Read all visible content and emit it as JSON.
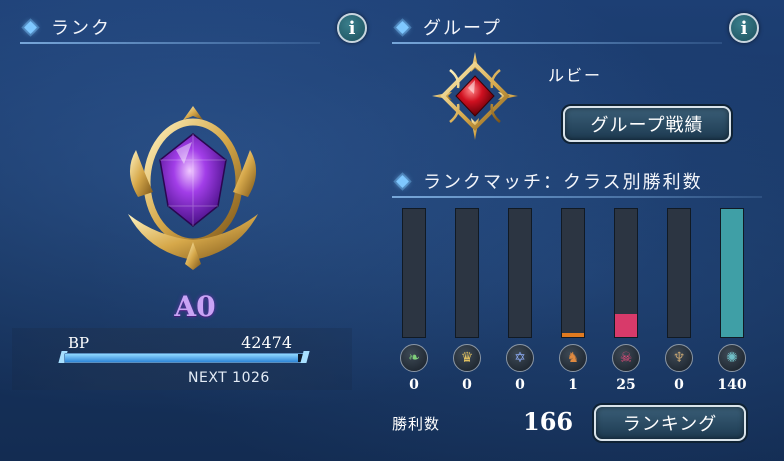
{
  "rank": {
    "header": "ランク",
    "name": "A0",
    "bp_label": "BP",
    "bp_value": "42474",
    "bp_progress": 0.97,
    "next_label": "NEXT 1026"
  },
  "group": {
    "header": "グループ",
    "name": "ルビー",
    "record_button": "グループ戦績"
  },
  "rank_match": {
    "header": "ランクマッチ：クラス別勝利数",
    "classes": [
      {
        "icon": "leaf-icon",
        "wins": 0,
        "fill": 0,
        "color": "#7fd07a",
        "bar_color": "#3aa0a8"
      },
      {
        "icon": "crown-icon",
        "wins": 0,
        "fill": 0,
        "color": "#e0c060",
        "bar_color": "#3aa0a8"
      },
      {
        "icon": "magic-circle-icon",
        "wins": 0,
        "fill": 0,
        "color": "#8aa8f0",
        "bar_color": "#3aa0a8"
      },
      {
        "icon": "dragon-icon",
        "wins": 1,
        "fill": 0.03,
        "color": "#e08a40",
        "bar_color": "#e07a20"
      },
      {
        "icon": "skull-icon",
        "wins": 25,
        "fill": 0.18,
        "color": "#e84a7a",
        "bar_color": "#d83a6a"
      },
      {
        "icon": "bat-wings-icon",
        "wins": 0,
        "fill": 0,
        "color": "#c0a070",
        "bar_color": "#3aa0a8"
      },
      {
        "icon": "swirl-icon",
        "wins": 140,
        "fill": 1.0,
        "color": "#70c0c8",
        "bar_color": "#3f9fa6"
      }
    ],
    "wins_label": "勝利数",
    "wins_total": "166",
    "ranking_button": "ランキング"
  },
  "info_icon_glyph": "i"
}
